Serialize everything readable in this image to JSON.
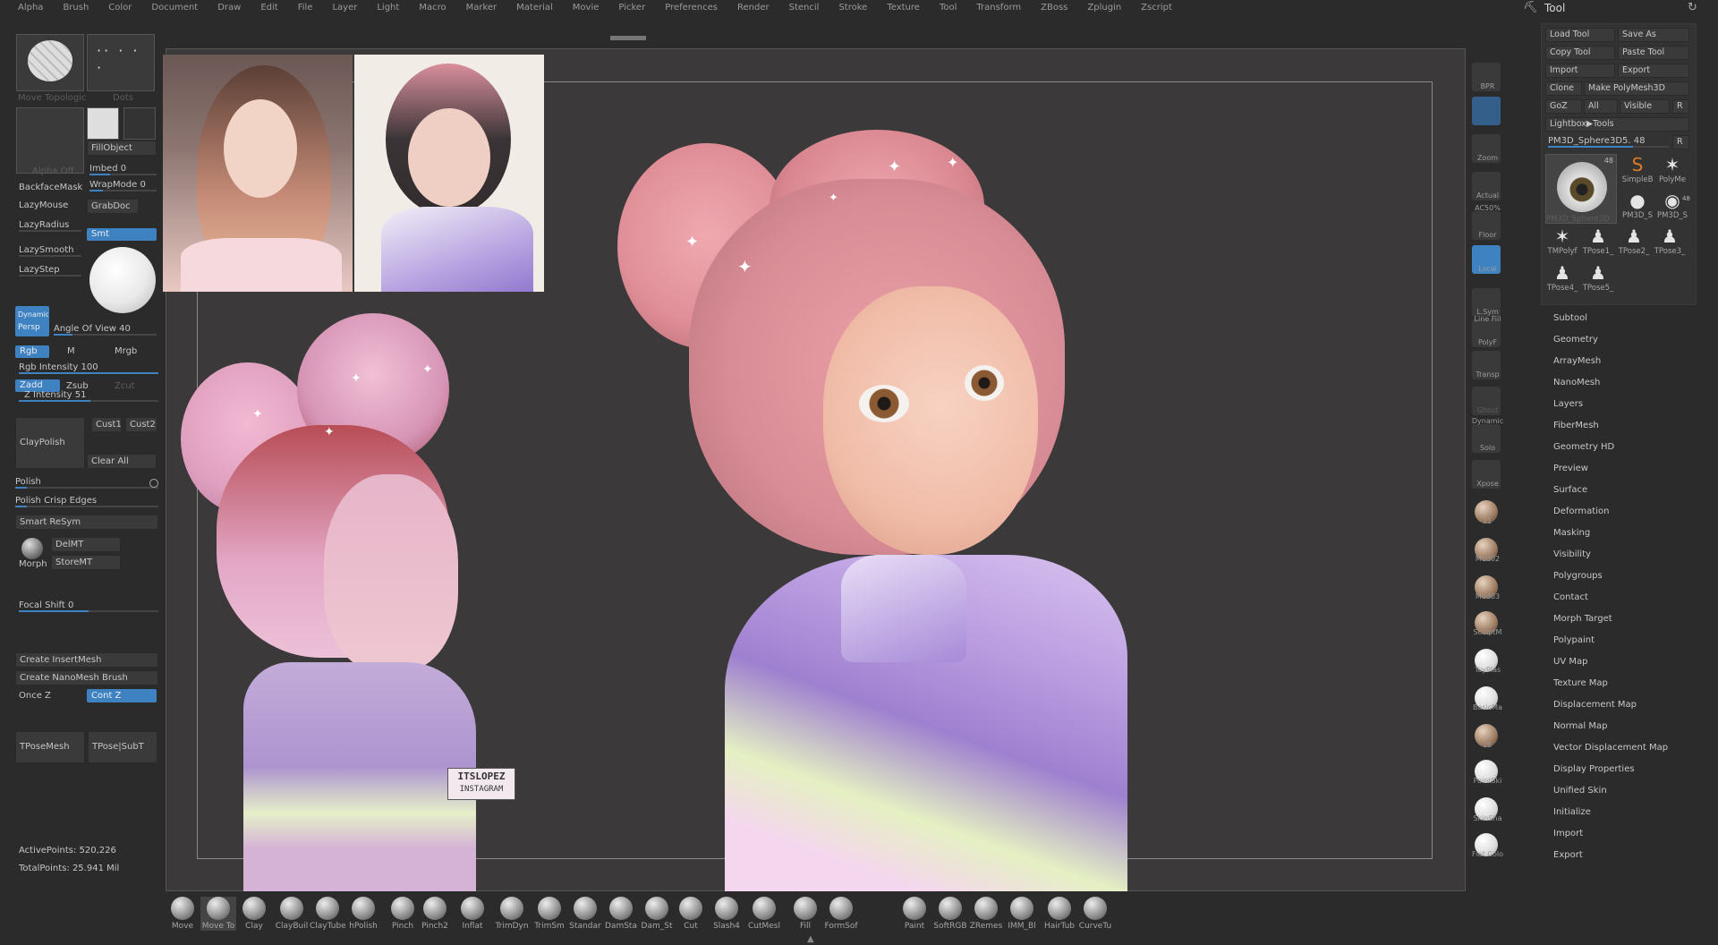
{
  "menubar": [
    "Alpha",
    "Brush",
    "Color",
    "Document",
    "Draw",
    "Edit",
    "File",
    "Layer",
    "Light",
    "Macro",
    "Marker",
    "Material",
    "Movie",
    "Picker",
    "Preferences",
    "Render",
    "Stencil",
    "Stroke",
    "Texture",
    "Tool",
    "Transform",
    "ZBoss",
    "Zplugin",
    "Zscript"
  ],
  "left": {
    "thumb1_label": "Move Topologic",
    "thumb2_label": "Dots",
    "alpha_label": "Alpha Off",
    "fill_object": "FillObject",
    "imbed": "Imbed 0",
    "backface": "BackfaceMask",
    "wrapmode": "WrapMode 0",
    "lazymouse": "LazyMouse",
    "grabdoc": "GrabDoc",
    "lazyradius": "LazyRadius",
    "smt": "Smt",
    "lazysmooth": "LazySmooth",
    "lazystep": "LazyStep",
    "dynamic": "Dynamic",
    "persp": "Persp",
    "angle": "Angle Of View 40",
    "rgb": "Rgb",
    "m": "M",
    "mrgb": "Mrgb",
    "rgb_intensity": "Rgb Intensity 100",
    "zadd": "Zadd",
    "zsub": "Zsub",
    "zcut": "Zcut",
    "z_intensity": "Z Intensity 51",
    "claypolish": "ClayPolish",
    "cust1": "Cust1",
    "cust2": "Cust2",
    "clear_all": "Clear All",
    "polish": "Polish",
    "polish_crisp": "Polish Crisp Edges",
    "smart_resym": "Smart ReSym",
    "delmt": "DelMT",
    "morph": "Morph",
    "storemt": "StoreMT",
    "focal_shift": "Focal Shift 0",
    "create_insertmesh": "Create InsertMesh",
    "create_nanomesh": "Create NanoMesh Brush",
    "once_z": "Once Z",
    "cont_z": "Cont Z",
    "tposemesh": "TPoseMesh",
    "tpose_subt": "TPose|SubT",
    "active_points": "ActivePoints: 520,226",
    "total_points": "TotalPoints: 25.941 Mil"
  },
  "reference": {
    "watermark_line1": "ITSLOPEZ",
    "watermark_line2": "INSTAGRAM"
  },
  "rail": [
    "BPR",
    "",
    "Zoom",
    "Actual",
    "Floor",
    "Local",
    "L.Sym",
    "PolyF",
    "Transp",
    "Ghost",
    "Solo",
    "Xpose",
    "z1",
    "Mud02",
    "Mud03",
    "SculptM",
    "ToyPlas",
    "BasicMa",
    "z8",
    "PaintSki",
    "SkinSha",
    "Flat Colo"
  ],
  "rail_pre": {
    "ac50": "AC50%",
    "line_fill": "Line Fill",
    "dynamic": "Dynamic"
  },
  "tool": {
    "title": "Tool",
    "load_tool": "Load Tool",
    "save_as": "Save As",
    "copy_tool": "Copy Tool",
    "paste_tool": "Paste Tool",
    "import": "Import",
    "export": "Export",
    "clone": "Clone",
    "make_polymesh": "Make PolyMesh3D",
    "goz": "GoZ",
    "all": "All",
    "visible": "Visible",
    "r": "R",
    "lightbox_tools": "Lightbox▶Tools",
    "current_tool": "PM3D_Sphere3D5. 48",
    "current_r": "R",
    "big_thumb_count": "48",
    "big_thumb_label": "PM3D_Sphere3D",
    "thumbs": [
      "SimpleB",
      "PolyMe",
      "PM3D_S",
      "PM3D_S",
      "TMPolyf",
      "TPose1_",
      "TPose2_",
      "TPose3_",
      "TPose4_",
      "TPose5_"
    ],
    "small_count": "48",
    "subpalettes": [
      "Subtool",
      "Geometry",
      "ArrayMesh",
      "NanoMesh",
      "Layers",
      "FiberMesh",
      "Geometry HD",
      "Preview",
      "Surface",
      "Deformation",
      "Masking",
      "Visibility",
      "Polygroups",
      "Contact",
      "Morph Target",
      "Polypaint",
      "UV Map",
      "Texture Map",
      "Displacement Map",
      "Normal Map",
      "Vector Displacement Map",
      "Display Properties",
      "Unified Skin",
      "Initialize",
      "Import",
      "Export"
    ]
  },
  "bottom_brushes": [
    "Move",
    "Move To",
    "Clay",
    "ClayBuil",
    "ClayTubes",
    "hPolish",
    "Pinch",
    "Pinch2",
    "Inflat",
    "TrimDyn",
    "TrimSm",
    "Standar",
    "DamSta",
    "Dam_St",
    "Cut",
    "Slash4",
    "CutMesl",
    "Fill",
    "FormSof",
    "Paint",
    "SoftRGB",
    "ZRemes",
    "IMM_Bl",
    "HairTub",
    "CurveTu"
  ],
  "colors": {
    "accent": "#3e82c1",
    "bg": "#2b2b2b",
    "canvas": "#3c393a",
    "hair": "#e8a3ac",
    "skin": "#f2c3b1",
    "jacket": "#b996d4"
  }
}
